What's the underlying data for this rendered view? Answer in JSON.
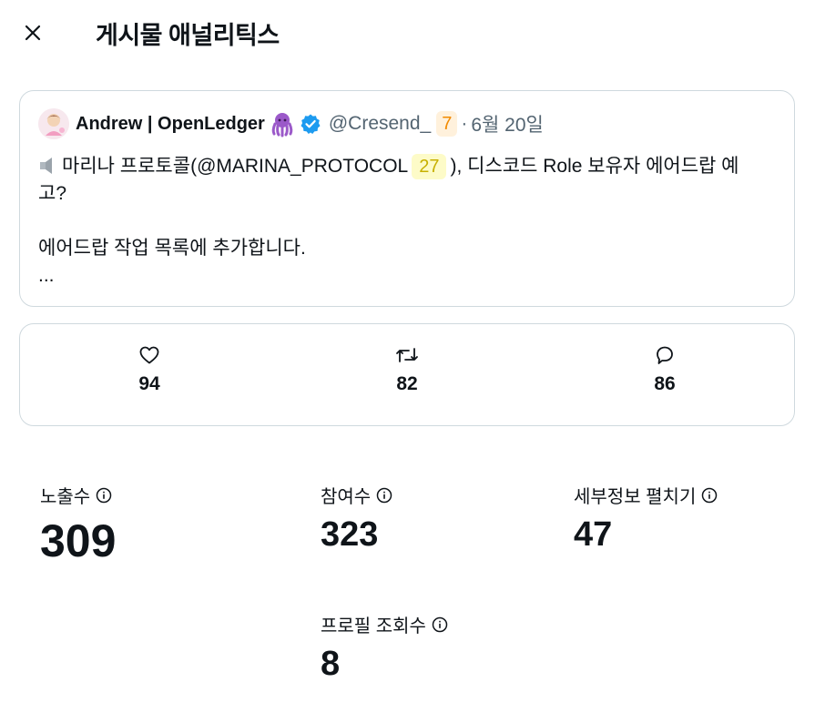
{
  "header": {
    "title": "게시물 애널리틱스",
    "close_icon": "close-icon"
  },
  "post": {
    "author_name": "Andrew | OpenLedger",
    "handle": "@Cresend_",
    "handle_badge": "7",
    "separator": "·",
    "date": "6월 20일",
    "line1_pre": "마리나 프로토콜(@MARINA_PROTOCOL",
    "mention_badge": "27",
    "line1_post": "), 디스코드 Role 보유자 에어드랍 예",
    "line2": "고?",
    "line3": "에어드랍 작업 목록에 추가합니다.",
    "line4": "..."
  },
  "engagement": {
    "likes": "94",
    "reposts": "82",
    "replies": "86"
  },
  "metrics": {
    "impressions_label": "노출수",
    "impressions_value": "309",
    "engagements_label": "참여수",
    "engagements_value": "323",
    "detail_expands_label": "세부정보 펼치기",
    "detail_expands_value": "47",
    "profile_visits_label": "프로필 조회수",
    "profile_visits_value": "8"
  },
  "colors": {
    "verified": "#1d9bf0",
    "muted_text": "#536471",
    "border": "#cfd9de"
  }
}
